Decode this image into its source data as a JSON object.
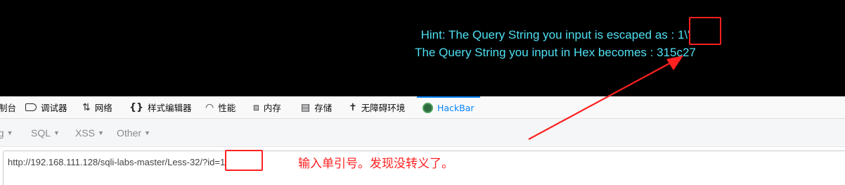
{
  "page": {
    "hint_escaped": "Hint: The Query String you input is escaped as : 1\\'",
    "hint_hex": "The Query String you input in Hex becomes : 315c27",
    "text_color": "#4ee0f2"
  },
  "devtools": {
    "tabs": [
      {
        "label": "制台",
        "icon": "console-icon"
      },
      {
        "label": "调试器",
        "icon": "debugger-icon"
      },
      {
        "label": "网络",
        "icon": "network-arrows-icon"
      },
      {
        "label": "样式编辑器",
        "icon": "braces-icon"
      },
      {
        "label": "性能",
        "icon": "gauge-icon"
      },
      {
        "label": "内存",
        "icon": "memory-chip-icon"
      },
      {
        "label": "存储",
        "icon": "storage-icon"
      },
      {
        "label": "无障碍环境",
        "icon": "accessibility-icon"
      },
      {
        "label": "HackBar",
        "icon": "hackbar-icon",
        "active": true
      }
    ],
    "active_color": "#0a84ff"
  },
  "hackbar": {
    "menus": [
      "ng",
      "SQL",
      "XSS",
      "Other"
    ],
    "url": "http://192.168.111.128/sqli-labs-master/Less-32/?id=1'"
  },
  "annotation": {
    "note": "输入单引号。发现没转义了。",
    "color": "#ff2020"
  }
}
